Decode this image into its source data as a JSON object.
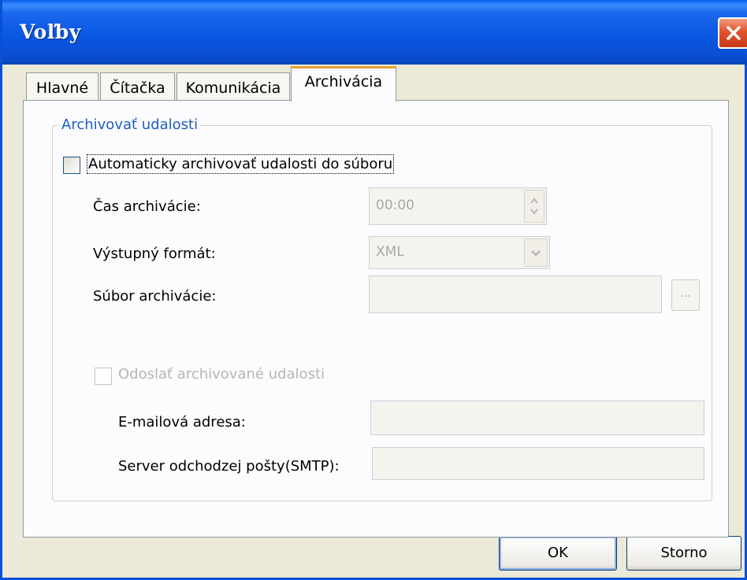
{
  "window": {
    "title": "Voľby"
  },
  "tabs": [
    {
      "label": "Hlavné"
    },
    {
      "label": "Čítačka"
    },
    {
      "label": "Komunikácia"
    },
    {
      "label": "Archivácia"
    }
  ],
  "group": {
    "label": "Archivovať udalosti",
    "auto_archive_label": "Automaticky archivovať udalosti do súboru",
    "time_label": "Čas archivácie:",
    "time_value": "00:00",
    "format_label": "Výstupný formát:",
    "format_value": "XML",
    "file_label": "Súbor archivácie:",
    "file_value": "",
    "browse_label": "...",
    "send_label": "Odoslať archivované udalosti",
    "email_label": "E-mailová adresa:",
    "email_value": "",
    "smtp_label": "Server odchodzej pošty(SMTP):",
    "smtp_value": ""
  },
  "buttons": {
    "ok": "OK",
    "cancel": "Storno"
  }
}
